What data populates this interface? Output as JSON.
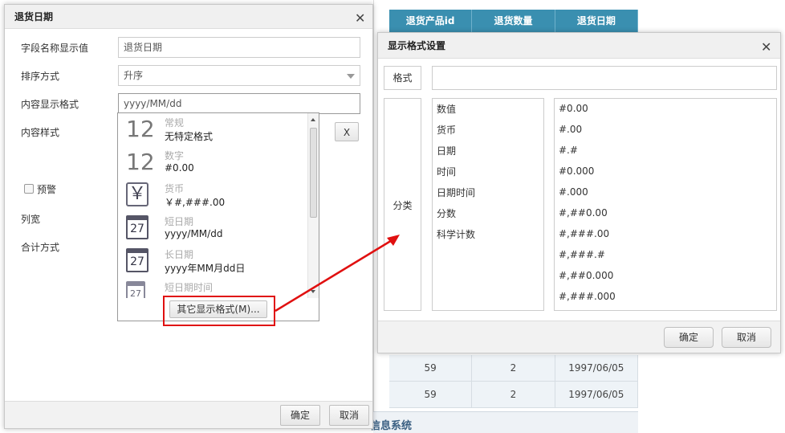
{
  "background_table": {
    "headers": [
      "退货产品id",
      "退货数量",
      "退货日期"
    ],
    "rows": [
      [
        "59",
        "2",
        "1997/06/05"
      ],
      [
        "59",
        "2",
        "1997/06/05"
      ]
    ],
    "footer_text": "信息系统"
  },
  "field_dialog": {
    "title": "退货日期",
    "labels": {
      "display_name": "字段名称显示值",
      "sort": "排序方式",
      "content_format": "内容显示格式",
      "content_style": "内容样式",
      "warning": "预警",
      "col_width": "列宽",
      "total_mode": "合计方式"
    },
    "display_name_value": "退货日期",
    "sort_value": "升序",
    "format_value": "yyyy/MM/dd",
    "clear_label": "X",
    "ok_label": "确定",
    "cancel_label": "取消"
  },
  "format_dropdown": {
    "items": [
      {
        "category": "常规",
        "example": "无特定格式",
        "icon": "number-12-icon",
        "glyph": "12"
      },
      {
        "category": "数字",
        "example": "#0.00",
        "icon": "number-12-icon",
        "glyph": "12"
      },
      {
        "category": "货币",
        "example": "￥#,###.00",
        "icon": "yen-icon",
        "glyph": "￥"
      },
      {
        "category": "短日期",
        "example": "yyyy/MM/dd",
        "icon": "calendar-icon",
        "glyph": "27"
      },
      {
        "category": "长日期",
        "example": "yyyy年MM月dd日",
        "icon": "calendar-icon",
        "glyph": "27"
      },
      {
        "category": "短日期时间",
        "example": "",
        "icon": "calendar-clock-icon",
        "glyph": "27"
      }
    ],
    "more_formats_label": "其它显示格式(M)..."
  },
  "format_dialog": {
    "title": "显示格式设置",
    "format_label": "格式",
    "format_value": "",
    "category_label": "分类",
    "categories": [
      "数值",
      "货币",
      "日期",
      "时间",
      "日期时间",
      "分数",
      "科学计数"
    ],
    "formats": [
      "#0.00",
      "#.00",
      "#.#",
      "#0.000",
      "#.000",
      "#,##0.00",
      "#,###.00",
      "#,###.#",
      "#,##0.000",
      "#,###.000"
    ],
    "ok_label": "确定",
    "cancel_label": "取消"
  },
  "colors": {
    "accent": "#3a8fb0",
    "annotation": "#e01010"
  }
}
